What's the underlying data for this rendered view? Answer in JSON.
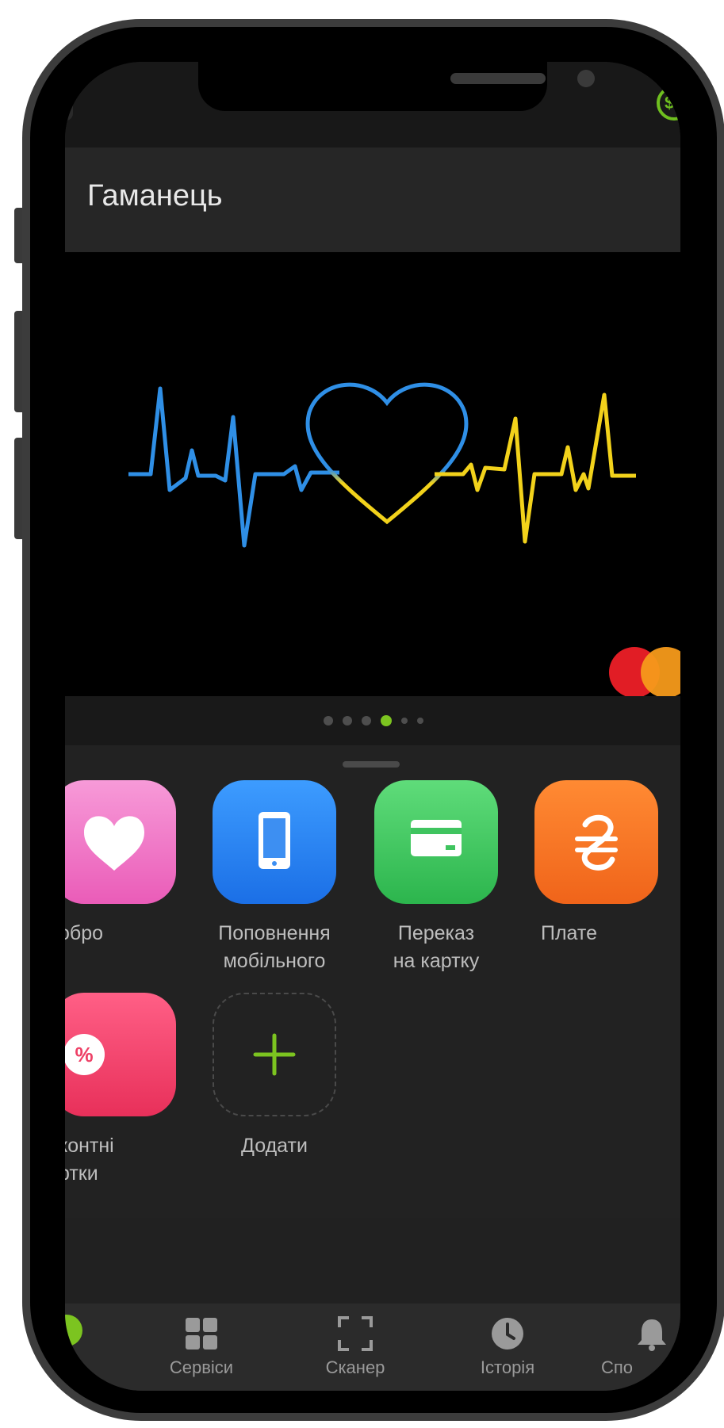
{
  "header": {
    "title": "Гаманець"
  },
  "card": {
    "brand": "mastercard",
    "art": "heartbeat-heart-blue-yellow",
    "colors": {
      "blue": "#2f8fe6",
      "yellow": "#f2d21b",
      "mastercard_red": "#e11d25",
      "mastercard_orange": "#f59a1a"
    }
  },
  "pager": {
    "count": 6,
    "active_index": 3
  },
  "services": {
    "items": [
      {
        "label_line1": "обро",
        "label_line2": "",
        "icon": "heart-icon",
        "color": "#f06fc6"
      },
      {
        "label_line1": "Поповнення",
        "label_line2": "мобільного",
        "icon": "smartphone-icon",
        "color": "#1f7ff0"
      },
      {
        "label_line1": "Переказ",
        "label_line2": "на картку",
        "icon": "credit-card-icon",
        "color": "#34c759"
      },
      {
        "label_line1": "Плате",
        "label_line2": "",
        "icon": "hryvnia-icon",
        "color": "#f47a1f"
      },
      {
        "label_line1": "контні",
        "label_line2": "ртки",
        "icon": "discount-icon",
        "color": "#f0406a"
      },
      {
        "label_line1": "Додати",
        "label_line2": "",
        "icon": "plus-icon",
        "color": "#7cc420"
      }
    ]
  },
  "tab_bar": {
    "tabs": [
      {
        "label": "",
        "icon": "wallet-icon"
      },
      {
        "label": "Сервіси",
        "icon": "grid-icon"
      },
      {
        "label": "Сканер",
        "icon": "scan-frame-icon"
      },
      {
        "label": "Історія",
        "icon": "clock-icon"
      },
      {
        "label": "Спо",
        "icon": "bell-icon"
      }
    ],
    "active_color": "#7cc420"
  }
}
